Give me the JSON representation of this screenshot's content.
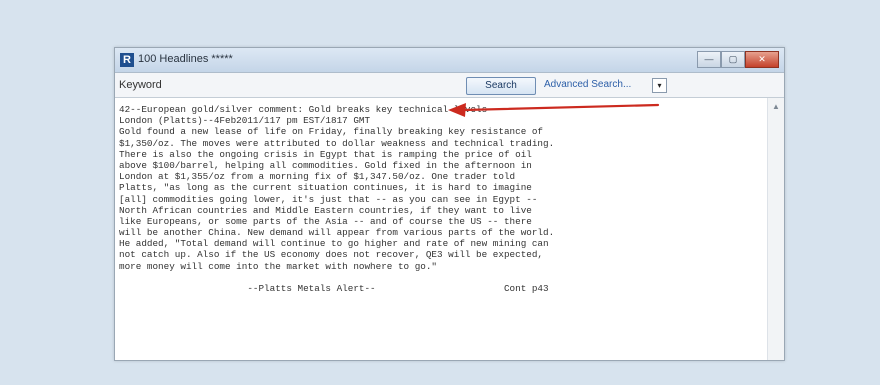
{
  "window": {
    "app_icon": "R",
    "title": "100 Headlines *****",
    "buttons": [
      "—",
      "▢",
      "✕"
    ]
  },
  "toolbar": {
    "keyword_label": "Keyword",
    "search_label": "Search",
    "advanced_search_label": "Advanced Search...",
    "dropdown_glyph": "▾"
  },
  "article": {
    "lines": [
      "42--European gold/silver comment: Gold breaks key technical levels",
      "London (Platts)--4Feb2011/117 pm EST/1817 GMT",
      "Gold found a new lease of life on Friday, finally breaking key resistance of",
      "$1,350/oz. The moves were attributed to dollar weakness and technical trading.",
      "There is also the ongoing crisis in Egypt that is ramping the price of oil",
      "above $100/barrel, helping all commodities. Gold fixed in the afternoon in",
      "London at $1,355/oz from a morning fix of $1,347.50/oz. One trader told",
      "Platts, \"as long as the current situation continues, it is hard to imagine",
      "[all] commodities going lower, it's just that -- as you can see in Egypt --",
      "North African countries and Middle Eastern countries, if they want to live",
      "like Europeans, or some parts of the Asia -- and of course the US -- there",
      "will be another China. New demand will appear from various parts of the world.",
      "He added, \"Total demand will continue to go higher and rate of new mining can",
      "not catch up. Also if the US economy does not recover, QE3 will be expected,",
      "more money will come into the market with nowhere to go.\""
    ],
    "footer": "                       --Platts Metals Alert--                       Cont p43"
  },
  "annotation": {
    "arrow_color": "#cc2a1f"
  },
  "scrollbar": {
    "up_glyph": "▲"
  }
}
